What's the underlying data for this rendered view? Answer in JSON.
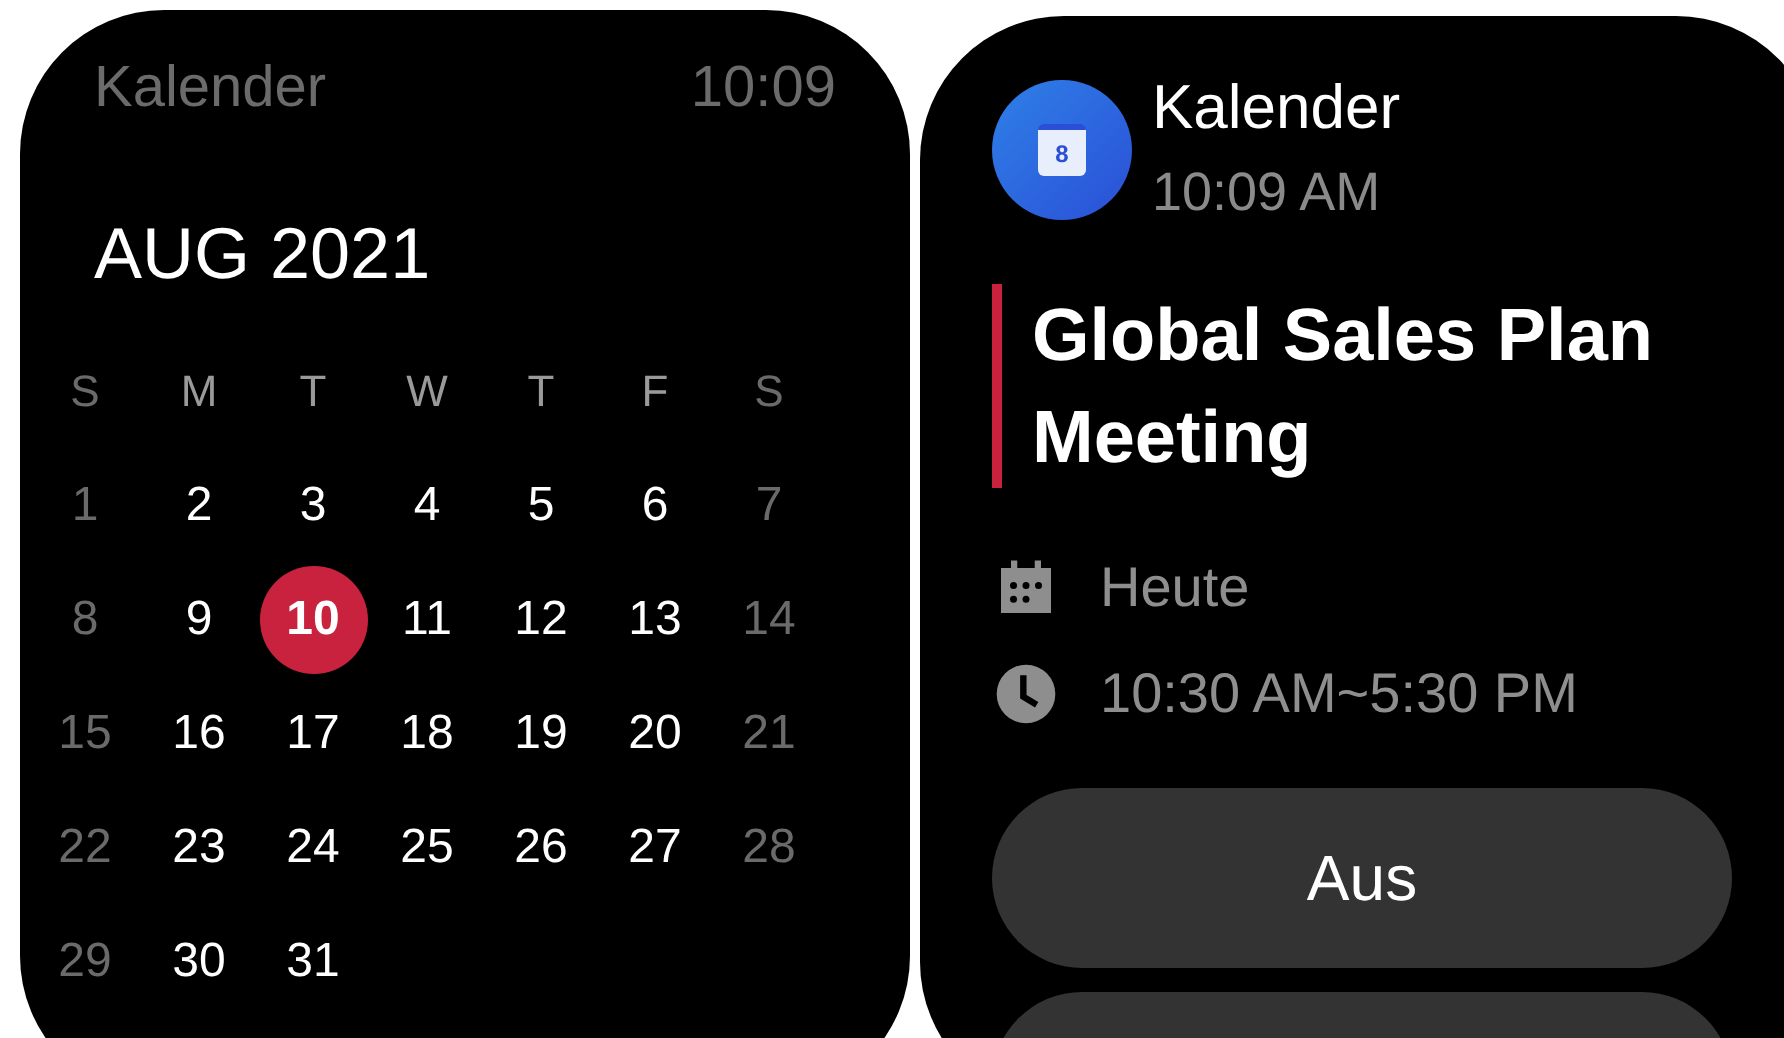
{
  "calendar_screen": {
    "app_title": "Kalender",
    "clock": "10:09",
    "month": "AUG 2021",
    "weekdays": [
      {
        "label": "S",
        "dimmed": true
      },
      {
        "label": "M",
        "dimmed": false
      },
      {
        "label": "T",
        "dimmed": false
      },
      {
        "label": "W",
        "dimmed": false
      },
      {
        "label": "T",
        "dimmed": false
      },
      {
        "label": "F",
        "dimmed": false
      },
      {
        "label": "S",
        "dimmed": true
      }
    ],
    "weeks": [
      [
        {
          "label": "1",
          "dimmed": true,
          "selected": false
        },
        {
          "label": "2",
          "dimmed": false,
          "selected": false
        },
        {
          "label": "3",
          "dimmed": false,
          "selected": false
        },
        {
          "label": "4",
          "dimmed": false,
          "selected": false
        },
        {
          "label": "5",
          "dimmed": false,
          "selected": false
        },
        {
          "label": "6",
          "dimmed": false,
          "selected": false
        },
        {
          "label": "7",
          "dimmed": true,
          "selected": false
        }
      ],
      [
        {
          "label": "8",
          "dimmed": true,
          "selected": false
        },
        {
          "label": "9",
          "dimmed": false,
          "selected": false
        },
        {
          "label": "10",
          "dimmed": false,
          "selected": true
        },
        {
          "label": "11",
          "dimmed": false,
          "selected": false
        },
        {
          "label": "12",
          "dimmed": false,
          "selected": false
        },
        {
          "label": "13",
          "dimmed": false,
          "selected": false
        },
        {
          "label": "14",
          "dimmed": true,
          "selected": false
        }
      ],
      [
        {
          "label": "15",
          "dimmed": true,
          "selected": false
        },
        {
          "label": "16",
          "dimmed": false,
          "selected": false
        },
        {
          "label": "17",
          "dimmed": false,
          "selected": false
        },
        {
          "label": "18",
          "dimmed": false,
          "selected": false
        },
        {
          "label": "19",
          "dimmed": false,
          "selected": false
        },
        {
          "label": "20",
          "dimmed": false,
          "selected": false
        },
        {
          "label": "21",
          "dimmed": true,
          "selected": false
        }
      ],
      [
        {
          "label": "22",
          "dimmed": true,
          "selected": false
        },
        {
          "label": "23",
          "dimmed": false,
          "selected": false
        },
        {
          "label": "24",
          "dimmed": false,
          "selected": false
        },
        {
          "label": "25",
          "dimmed": false,
          "selected": false
        },
        {
          "label": "26",
          "dimmed": false,
          "selected": false
        },
        {
          "label": "27",
          "dimmed": false,
          "selected": false
        },
        {
          "label": "28",
          "dimmed": true,
          "selected": false
        }
      ],
      [
        {
          "label": "29",
          "dimmed": true,
          "selected": false
        },
        {
          "label": "30",
          "dimmed": false,
          "selected": false
        },
        {
          "label": "31",
          "dimmed": false,
          "selected": false
        }
      ]
    ]
  },
  "notification_screen": {
    "app_name": "Kalender",
    "app_icon_day": "8",
    "received": "10:09 AM",
    "events": [
      {
        "title": "Global Sales Plan Meeting",
        "color": "#c8223f"
      }
    ],
    "details": [
      {
        "kind": "date",
        "text": "Heute"
      },
      {
        "kind": "time",
        "text": "10:30 AM~5:30 PM"
      }
    ],
    "buttons": [
      {
        "kind": "labeled",
        "label": "Aus"
      },
      {
        "kind": "cut_off"
      }
    ]
  }
}
